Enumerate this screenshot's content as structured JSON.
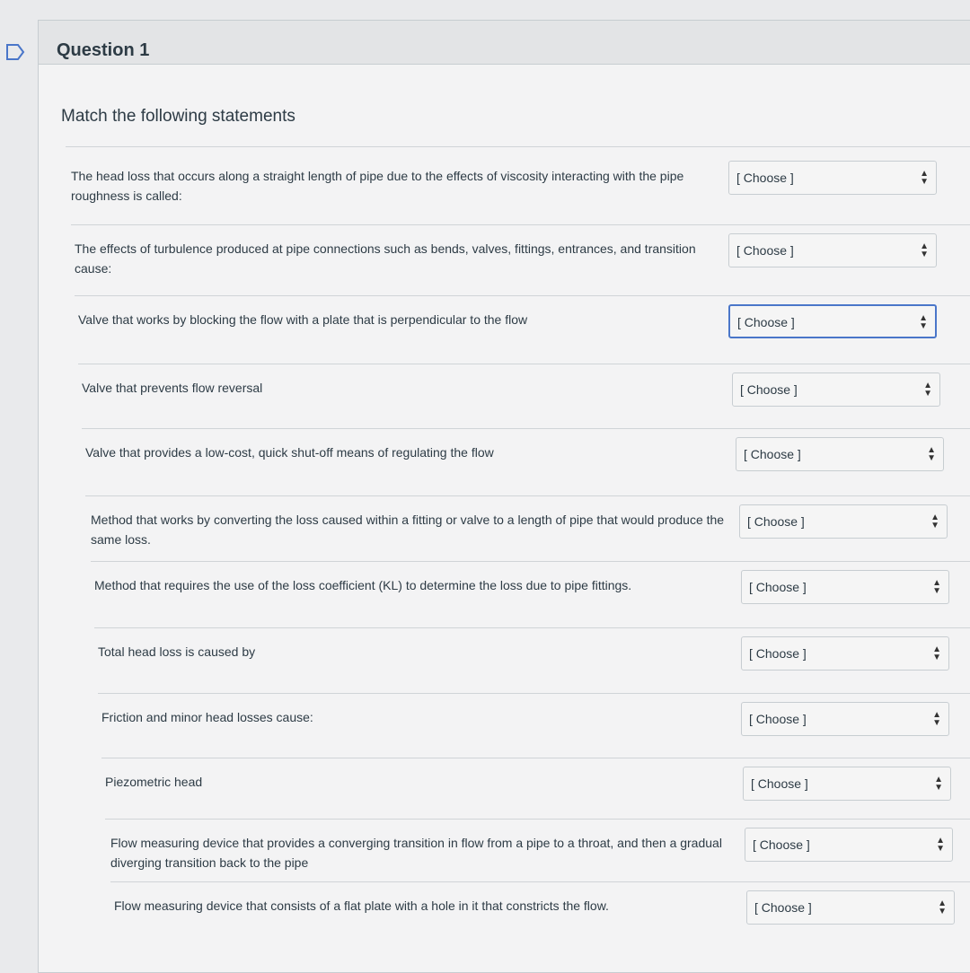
{
  "question": {
    "title": "Question 1",
    "prompt": "Match the following statements"
  },
  "select_placeholder": "[ Choose ]",
  "items": [
    {
      "text": "The head loss that occurs along a straight length of pipe due to the effects of viscosity interacting with the pipe roughness is called:",
      "selected": "[ Choose ]"
    },
    {
      "text": "The effects of turbulence produced at pipe connections such as bends, valves, fittings, entrances, and transition cause:",
      "selected": "[ Choose ]"
    },
    {
      "text": "Valve that works by blocking the flow with a plate that is perpendicular to the flow",
      "selected": "[ Choose ]"
    },
    {
      "text": "Valve that prevents flow reversal",
      "selected": "[ Choose ]"
    },
    {
      "text": "Valve that provides a low-cost, quick shut-off means of regulating the flow",
      "selected": "[ Choose ]"
    },
    {
      "text": "Method that works by converting the loss caused within a fitting or valve to a length of pipe that would produce the same loss.",
      "selected": "[ Choose ]"
    },
    {
      "text": "Method that requires the use of the loss coefficient (KL) to determine the loss due to pipe fittings.",
      "selected": "[ Choose ]"
    },
    {
      "text": "Total head loss is caused by",
      "selected": "[ Choose ]"
    },
    {
      "text": "Friction and minor head losses cause:",
      "selected": "[ Choose ]"
    },
    {
      "text": "Piezometric head",
      "selected": "[ Choose ]"
    },
    {
      "text": "Flow measuring device that provides a converging transition in flow from a pipe to a throat, and then a gradual diverging transition back to the pipe",
      "selected": "[ Choose ]"
    },
    {
      "text": "Flow measuring device that consists of a flat plate with a hole in it that constricts the flow.",
      "selected": "[ Choose ]"
    }
  ],
  "icons": {
    "flag": "flag-outline-icon",
    "select_arrow": "updown-arrows-icon"
  },
  "colors": {
    "focus": "#4a76c9",
    "text": "#2d3b45"
  }
}
